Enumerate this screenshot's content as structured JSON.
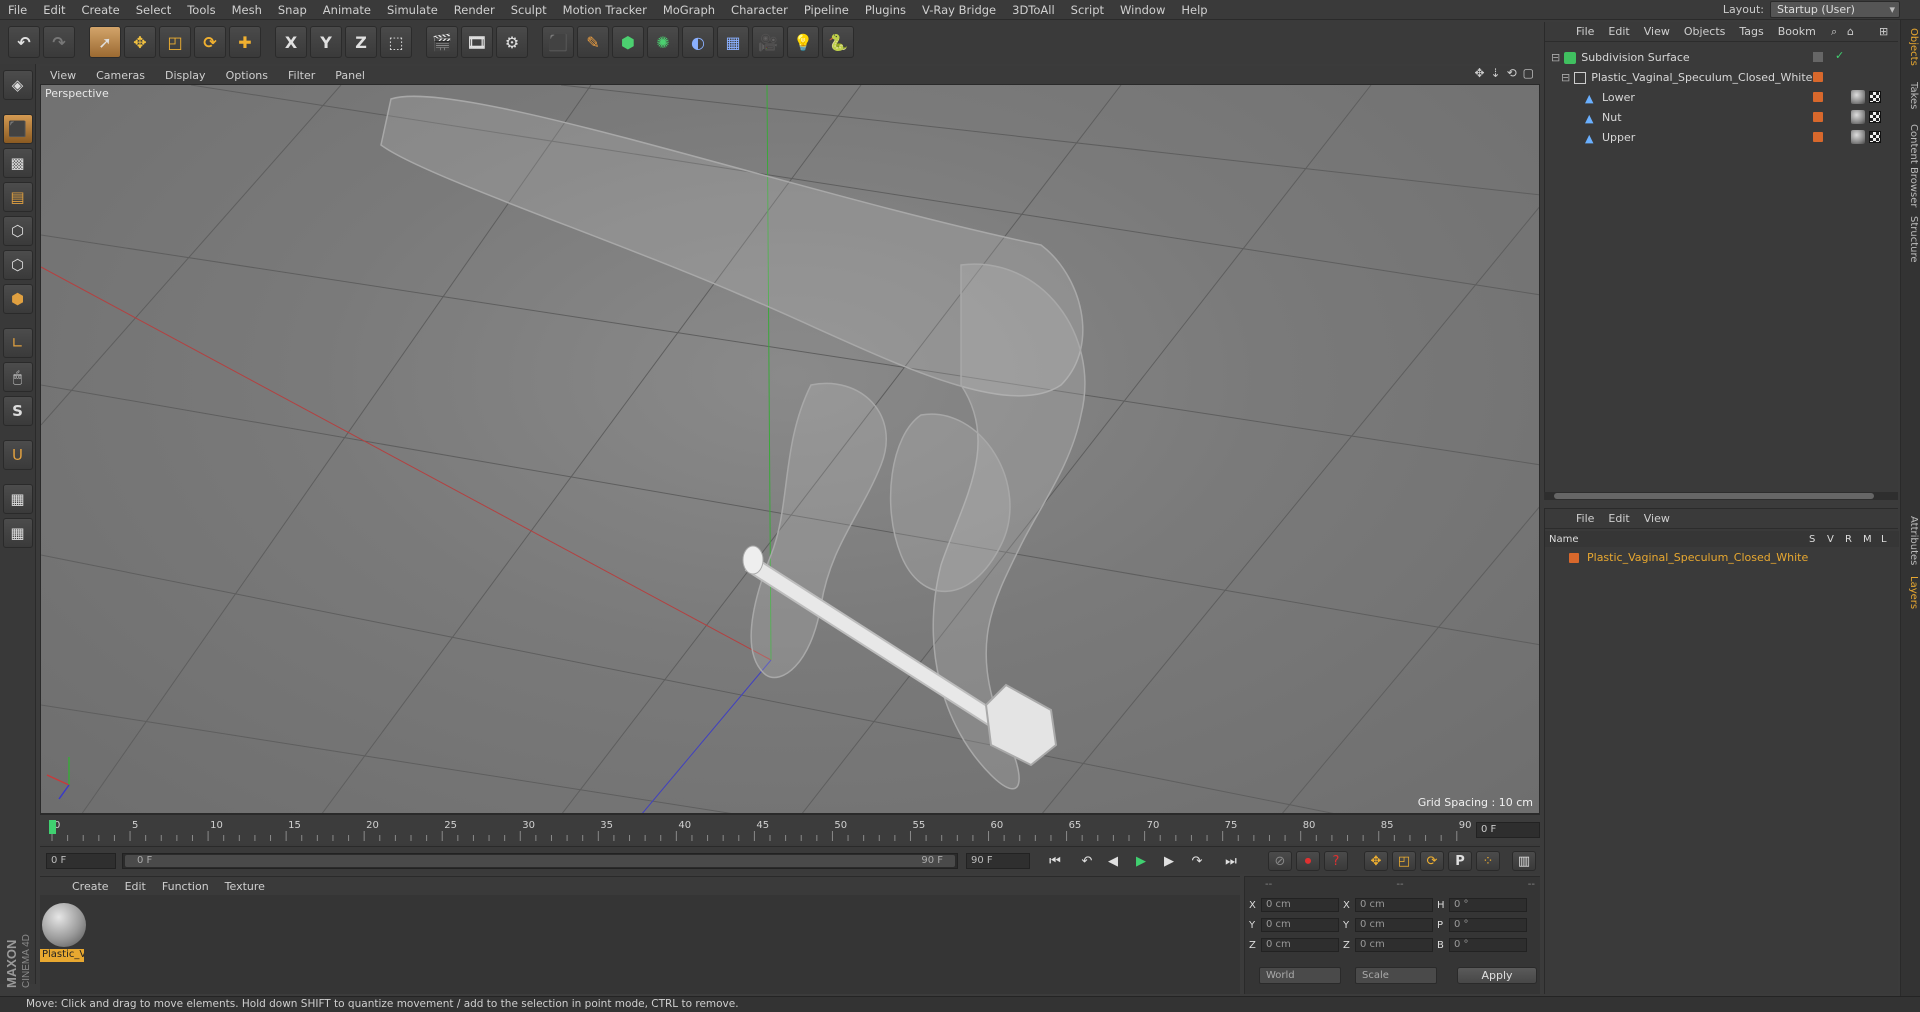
{
  "menubar": {
    "items": [
      "File",
      "Edit",
      "Create",
      "Select",
      "Tools",
      "Mesh",
      "Snap",
      "Animate",
      "Simulate",
      "Render",
      "Sculpt",
      "Motion Tracker",
      "MoGraph",
      "Character",
      "Pipeline",
      "Plugins",
      "V-Ray Bridge",
      "3DToAll",
      "Script",
      "Window",
      "Help"
    ],
    "layout_label": "Layout:",
    "layout_value": "Startup (User)"
  },
  "toolbar": {
    "axis_x": "X",
    "axis_y": "Y",
    "axis_z": "Z"
  },
  "viewport_menu": {
    "items": [
      "View",
      "Cameras",
      "Display",
      "Options",
      "Filter",
      "Panel"
    ]
  },
  "viewport": {
    "label": "Perspective",
    "grid_spacing": "Grid Spacing : 10 cm"
  },
  "timeline": {
    "ticks": [
      "0",
      "5",
      "10",
      "15",
      "20",
      "25",
      "30",
      "35",
      "40",
      "45",
      "50",
      "55",
      "60",
      "65",
      "70",
      "75",
      "80",
      "85",
      "90"
    ],
    "current_frame": "0 F"
  },
  "transport": {
    "start_field": "0 F",
    "range_start": "0 F",
    "range_end": "90 F",
    "end_field": "90 F"
  },
  "materials": {
    "menu": [
      "Create",
      "Edit",
      "Function",
      "Texture"
    ],
    "item_label": "Plastic_V"
  },
  "coords": {
    "headers": [
      "--",
      "--",
      "--"
    ],
    "rows": [
      {
        "a": "X",
        "av": "0 cm",
        "b": "X",
        "bv": "0 cm",
        "c": "H",
        "cv": "0 °"
      },
      {
        "a": "Y",
        "av": "0 cm",
        "b": "Y",
        "bv": "0 cm",
        "c": "P",
        "cv": "0 °"
      },
      {
        "a": "Z",
        "av": "0 cm",
        "b": "Z",
        "bv": "0 cm",
        "c": "B",
        "cv": "0 °"
      }
    ],
    "world": "World",
    "scale": "Scale",
    "apply": "Apply"
  },
  "objects_panel": {
    "menu": [
      "File",
      "Edit",
      "View",
      "Objects",
      "Tags",
      "Bookm"
    ],
    "items": [
      {
        "label": "Subdivision Surface"
      },
      {
        "label": "Plastic_Vaginal_Speculum_Closed_White"
      },
      {
        "label": "Lower"
      },
      {
        "label": "Nut"
      },
      {
        "label": "Upper"
      }
    ]
  },
  "layers_panel": {
    "menu": [
      "File",
      "Edit",
      "View"
    ],
    "head_name": "Name",
    "head_cols": [
      "S",
      "V",
      "R",
      "M",
      "L"
    ],
    "layer": "Plastic_Vaginal_Speculum_Closed_White"
  },
  "right_tabs": [
    "Objects",
    "Takes",
    "Content Browser",
    "Structure",
    "Attributes",
    "Layers"
  ],
  "status": "Move: Click and drag to move elements. Hold down SHIFT to quantize movement / add to the selection in point mode, CTRL to remove.",
  "logo": {
    "line1": "MAXON",
    "line2": "CINEMA 4D"
  },
  "colors": {
    "accent": "#e8a830",
    "object_tag": "#d8682c",
    "x_axis": "#c83a3a",
    "y_axis": "#3aa83a",
    "z_axis": "#3a3ac8"
  }
}
